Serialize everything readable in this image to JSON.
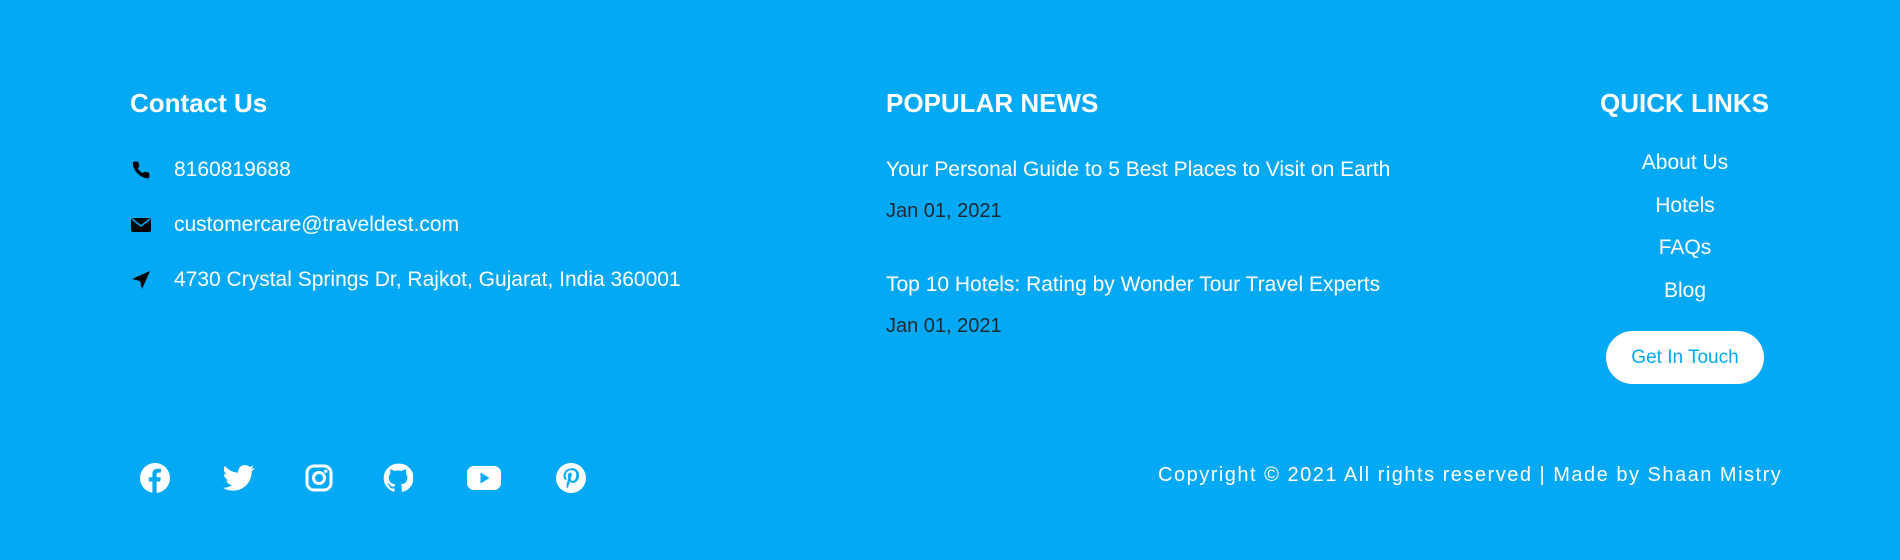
{
  "contact": {
    "title": "Contact Us",
    "phone": "8160819688",
    "email": "customercare@traveldest.com",
    "address": "4730 Crystal Springs Dr, Rajkot, Gujarat, India 360001"
  },
  "news": {
    "title": "POPULAR NEWS",
    "items": [
      {
        "headline": "Your Personal Guide to 5 Best Places to Visit on Earth",
        "date": "Jan 01, 2021"
      },
      {
        "headline": "Top 10 Hotels: Rating by Wonder Tour Travel Experts",
        "date": "Jan 01, 2021"
      }
    ]
  },
  "quick_links": {
    "title": "QUICK LINKS",
    "items": [
      "About Us",
      "Hotels",
      "FAQs",
      "Blog"
    ],
    "cta_label": "Get In Touch"
  },
  "social": {
    "icons": [
      "facebook-icon",
      "twitter-icon",
      "instagram-icon",
      "github-icon",
      "youtube-icon",
      "pinterest-icon"
    ]
  },
  "copyright": "Copyright © 2021 All rights reserved | Made by Shaan Mistry",
  "colors": {
    "background": "#04a9f5",
    "text": "#ffffff",
    "date_text": "#1b2a33",
    "icon_dark": "#000000",
    "button_bg": "#ffffff",
    "button_text": "#04a9f5"
  }
}
